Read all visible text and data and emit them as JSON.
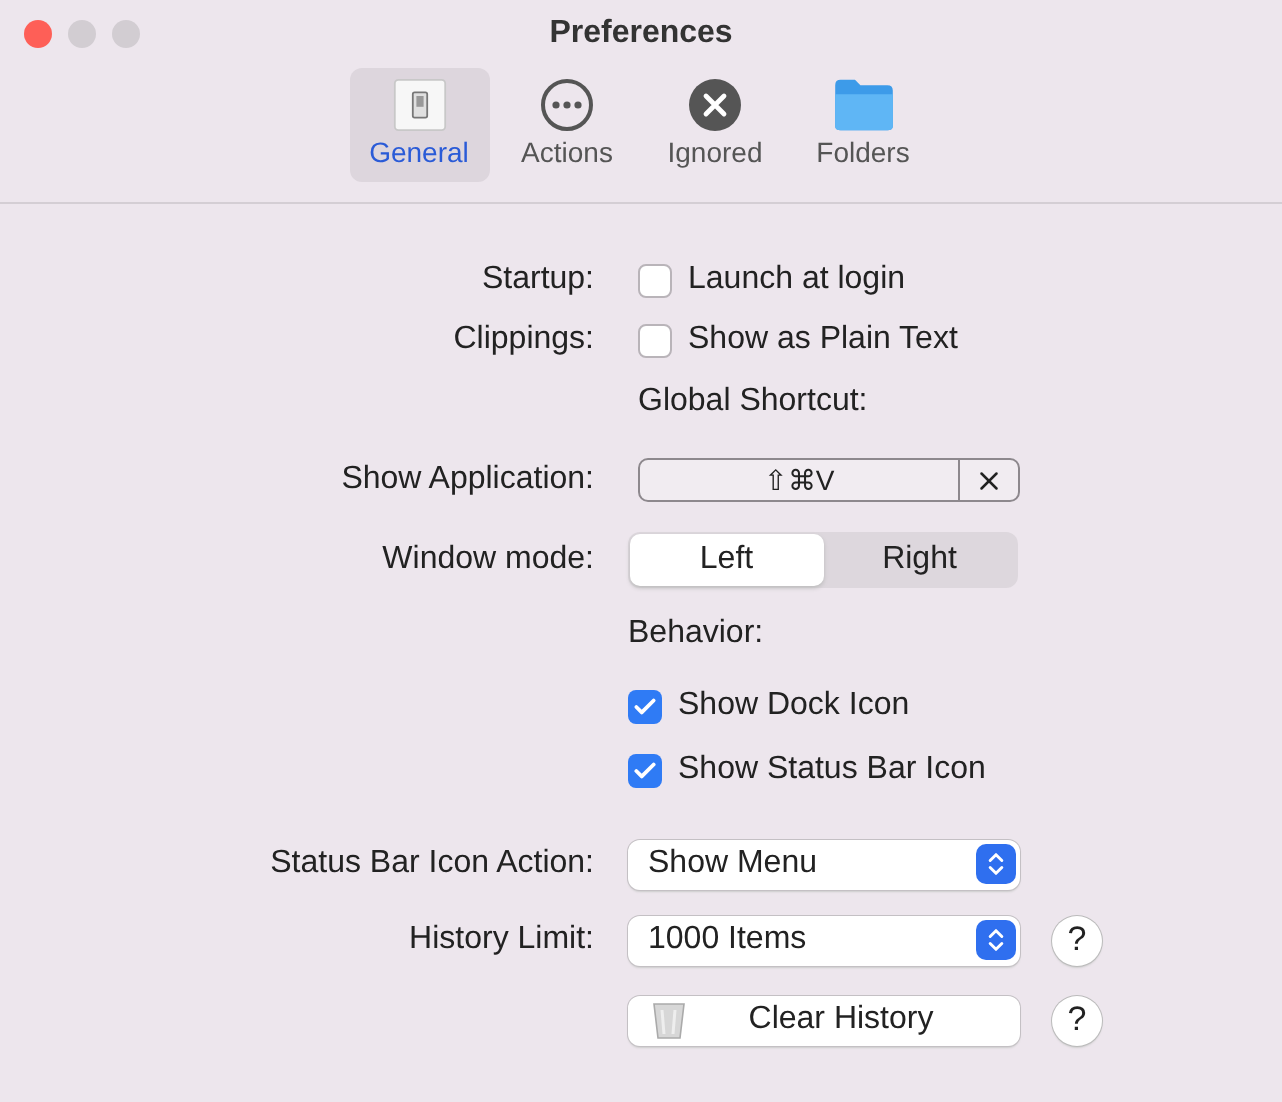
{
  "window": {
    "title": "Preferences"
  },
  "tabs": [
    {
      "label": "General",
      "kind": "switch",
      "selected": true
    },
    {
      "label": "Actions",
      "kind": "ellipsis",
      "selected": false
    },
    {
      "label": "Ignored",
      "kind": "cross",
      "selected": false
    },
    {
      "label": "Folders",
      "kind": "folder",
      "selected": false
    }
  ],
  "rows": [
    {
      "kind": "checkbox",
      "label": "Startup:",
      "text": "Launch at login",
      "checked": false
    },
    {
      "kind": "checkbox",
      "label": "Clippings:",
      "text": "Show as Plain Text",
      "checked": false
    },
    {
      "kind": "heading",
      "text": "Global Shortcut:"
    },
    {
      "kind": "shortcut",
      "label": "Show Application:",
      "value": "⇧⌘V"
    },
    {
      "kind": "segmented",
      "label": "Window mode:",
      "options": [
        {
          "label": "Left",
          "selected": true
        },
        {
          "label": "Right",
          "selected": false
        }
      ]
    },
    {
      "kind": "heading",
      "text": "Behavior:"
    },
    {
      "kind": "checkbox",
      "text": "Show Dock Icon",
      "checked": true
    },
    {
      "kind": "checkbox",
      "text": "Show Status Bar Icon",
      "checked": true
    },
    {
      "kind": "select",
      "label": "Status Bar Icon Action:",
      "value": "Show Menu"
    },
    {
      "kind": "select",
      "label": "History Limit:",
      "value": "1000 Items",
      "help": "?"
    },
    {
      "kind": "button",
      "text": "Clear History",
      "help": "?"
    }
  ]
}
